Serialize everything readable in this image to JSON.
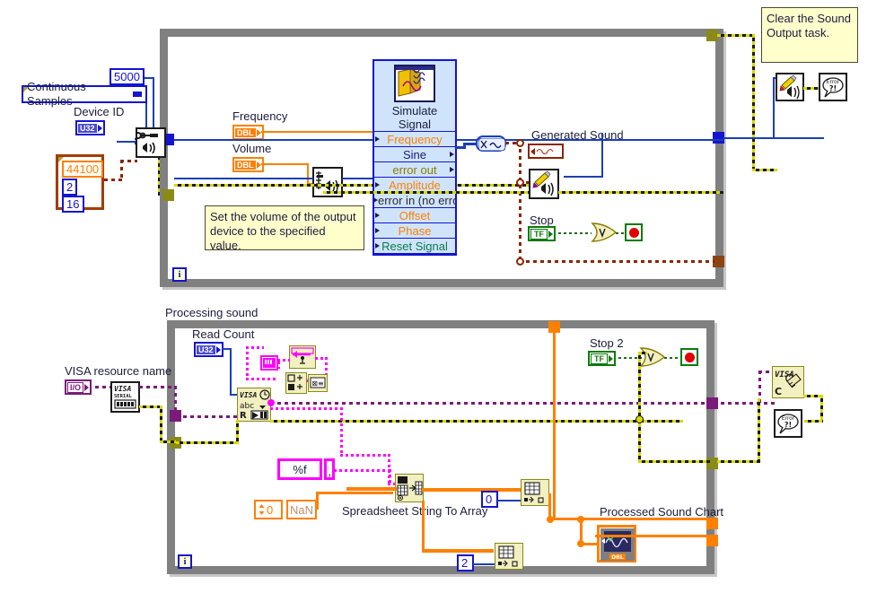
{
  "diagram": {
    "kind": "labview-block-diagram",
    "background": "#ffffff"
  },
  "comments": [
    {
      "name": "clear-sound-output-comment",
      "text": "Clear the Sound\nOutput task."
    },
    {
      "name": "set-volume-comment",
      "text": "Set the volume of the output\ndevice to the specified value."
    }
  ],
  "loops": [
    {
      "name": "sound-generation-loop",
      "label": "",
      "iteration_label": "i"
    },
    {
      "name": "processing-sound-loop",
      "label": "Processing sound",
      "iteration_label": "i"
    }
  ],
  "labels": {
    "device_id": "Device ID",
    "frequency": "Frequency",
    "volume": "Volume",
    "generated_sound": "Generated Sound",
    "stop": "Stop",
    "processing_sound": "Processing sound",
    "read_count": "Read Count",
    "visa_resource_name": "VISA resource name",
    "stop_2": "Stop 2",
    "spreadsheet_string_to_array": "Spreadsheet String To Array",
    "processed_sound_chart": "Processed Sound Chart"
  },
  "terminals": {
    "device_id": {
      "type": "U32",
      "label": "U32"
    },
    "frequency": {
      "type": "DBL",
      "label": "DBL"
    },
    "volume": {
      "type": "DBL",
      "label": "DBL"
    },
    "generated_sound": {
      "type": "dynamic-data",
      "label": ""
    },
    "stop": {
      "type": "Boolean",
      "label": "TF"
    },
    "read_count": {
      "type": "U32",
      "label": "U32"
    },
    "visa_resource_name": {
      "type": "VISA I/O",
      "label": "I/O"
    },
    "stop_2": {
      "type": "Boolean",
      "label": "TF"
    }
  },
  "constants": {
    "samples_per_channel": "5000",
    "sample_mode": "Continuous Samples",
    "sample_rate": "44100",
    "channels": "2",
    "bits_per_sample": "16",
    "index_array_0": "0",
    "index_array_2": "2",
    "array_index_0": "0",
    "numeric_zero": "0",
    "nan": "NaN",
    "format_string": "%f",
    "delimiter": ","
  },
  "express_vi": {
    "name": "Simulate Signal",
    "title": "Simulate Signal",
    "rows": [
      {
        "label": "Frequency",
        "color": "#ff8000",
        "left_terminal": true,
        "right_terminal": false
      },
      {
        "label": "Sine",
        "color": "#1a1a7a",
        "left_terminal": false,
        "right_terminal": true
      },
      {
        "label": "error out",
        "color": "#8a7a00",
        "left_terminal": false,
        "right_terminal": true
      },
      {
        "label": "Amplitude",
        "color": "#ff8000",
        "left_terminal": true,
        "right_terminal": false
      },
      {
        "label": "error in (no error)",
        "color": "#2c2c2c",
        "left_terminal": true,
        "right_terminal": false
      },
      {
        "label": "Offset",
        "color": "#ff8000",
        "left_terminal": true,
        "right_terminal": false
      },
      {
        "label": "Phase",
        "color": "#ff8000",
        "left_terminal": true,
        "right_terminal": false
      },
      {
        "label": "Reset Signal",
        "color": "#0a7a4a",
        "left_terminal": true,
        "right_terminal": false
      }
    ]
  },
  "nodes": [
    {
      "name": "sound-output-configure-node",
      "icon": "wrench-speaker-icon"
    },
    {
      "name": "sound-output-set-volume-node",
      "icon": "slider-speaker-icon"
    },
    {
      "name": "from-dynamic-data-node",
      "icon": "convert-dynamic-data-icon"
    },
    {
      "name": "sound-output-write-node",
      "icon": "pencil-speaker-icon"
    },
    {
      "name": "sound-output-clear-node",
      "icon": "pencil-eraser-speaker-icon"
    },
    {
      "name": "simple-error-handler-node-top",
      "icon": "error-dialog-icon"
    },
    {
      "name": "visa-configure-serial-port-node",
      "icon": "visa-serial-icon"
    },
    {
      "name": "visa-read-node",
      "icon": "visa-read-icon"
    },
    {
      "name": "visa-close-node",
      "icon": "visa-close-icon"
    },
    {
      "name": "simple-error-handler-node-bottom",
      "icon": "error-dialog-icon"
    },
    {
      "name": "bytes-at-port-property-node",
      "icon": "property-node-icon"
    },
    {
      "name": "string-length-node",
      "icon": "string-length-icon"
    },
    {
      "name": "not-equal-zero-node",
      "icon": "compare-icon"
    },
    {
      "name": "spreadsheet-string-to-array-node",
      "icon": "spreadsheet-to-array-icon"
    },
    {
      "name": "index-array-node-0",
      "icon": "index-array-icon"
    },
    {
      "name": "index-array-node-2",
      "icon": "index-array-icon"
    },
    {
      "name": "or-node-top",
      "icon": "or-gate-icon"
    },
    {
      "name": "or-node-bottom",
      "icon": "or-gate-icon"
    },
    {
      "name": "stop-node-top",
      "icon": "stop-sign-icon"
    },
    {
      "name": "stop-node-bottom",
      "icon": "stop-sign-icon"
    },
    {
      "name": "processed-sound-chart-indicator",
      "icon": "waveform-chart-icon"
    }
  ],
  "colors": {
    "loop_frame": "#808080",
    "error_wire": "#d8d800",
    "dynamic_data_wire": "#8b2500",
    "numeric_wire": "#ff8000",
    "boolean_wire": "#1a6b1a",
    "visa_wire": "#7a1a7a",
    "string_wire": "#ff00ff",
    "blue_wire": "#1c3fb4",
    "express_vi_bg": "#cfe4fb",
    "comment_bg": "#ffffcc",
    "node_bg": "#f2efc0"
  }
}
